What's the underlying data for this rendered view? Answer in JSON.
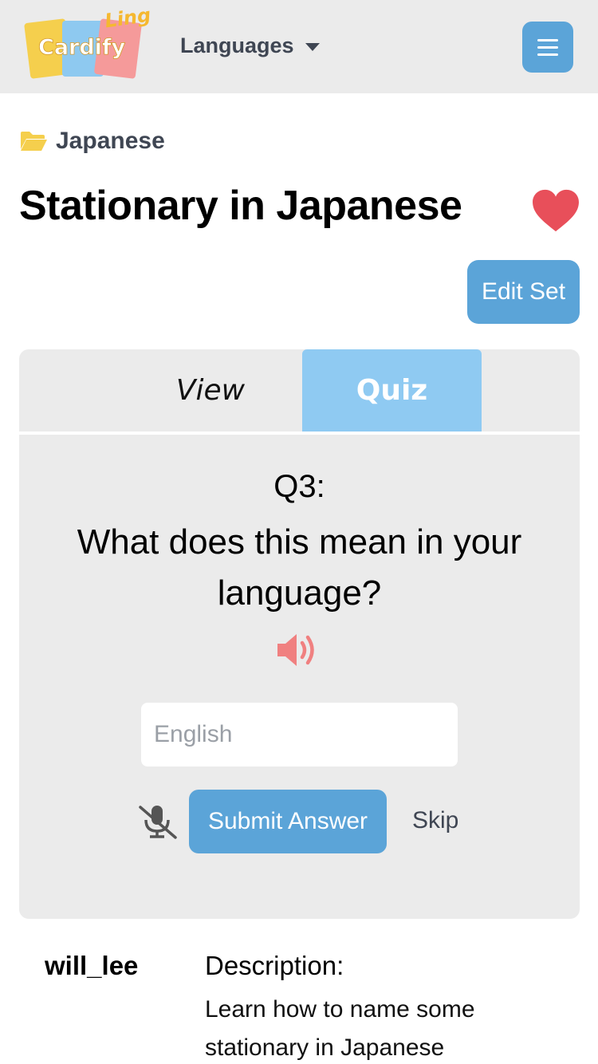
{
  "header": {
    "logo_top": "Lingo",
    "logo_main": "Cardify",
    "languages_label": "Languages"
  },
  "breadcrumb": {
    "folder": "Japanese"
  },
  "set": {
    "title": "Stationary in Japanese"
  },
  "actions": {
    "edit_label": "Edit Set"
  },
  "tabs": [
    {
      "label": "View",
      "active": false
    },
    {
      "label": "Quiz",
      "active": true
    }
  ],
  "quiz": {
    "number": "Q3:",
    "question": "What does this mean in your language?",
    "answer_placeholder": "English",
    "answer_value": "",
    "submit_label": "Submit Answer",
    "skip_label": "Skip"
  },
  "meta": {
    "author": "will_lee",
    "description_label": "Description:",
    "description": "Learn how to name some stationary in Japanese"
  },
  "colors": {
    "accent": "#5ba4d8",
    "tab_active": "#8fcaf2",
    "heart": "#e84f5a",
    "speaker": "#f08080",
    "panel": "#ebebeb"
  }
}
